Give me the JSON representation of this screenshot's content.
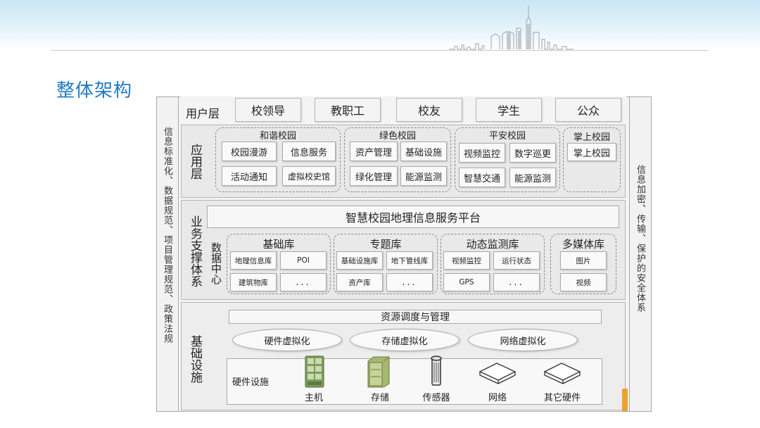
{
  "title": "整体架构",
  "left_bar": "信息标准化、数据规范、项目管理规范、政策法规",
  "right_bar": "信息加密、传输、保护的安全体系",
  "user_layer": {
    "label": "用户层",
    "items": [
      "校领导",
      "教职工",
      "校友",
      "学生",
      "公众"
    ]
  },
  "app_layer": {
    "label": "应用层",
    "groups": [
      {
        "title": "和谐校园",
        "items": [
          "校园漫游",
          "信息服务",
          "活动通知",
          "虚拟校史馆"
        ]
      },
      {
        "title": "绿色校园",
        "items": [
          "资产管理",
          "基础设施",
          "绿化管理",
          "能源监测"
        ]
      },
      {
        "title": "平安校园",
        "items": [
          "视频监控",
          "数字巡更",
          "智慧交通",
          "能源监测"
        ]
      },
      {
        "title": "掌上校园",
        "items": [
          "掌上校园"
        ]
      }
    ]
  },
  "support_layer": {
    "label": "业务支撑体系",
    "platform": "智慧校园地理信息服务平台",
    "data_center": "数据中心",
    "groups": [
      {
        "title": "基础库",
        "items": [
          "地理信息库",
          "POI",
          "建筑物库",
          "..."
        ]
      },
      {
        "title": "专题库",
        "items": [
          "基础设施库",
          "地下管线库",
          "资产库",
          "..."
        ]
      },
      {
        "title": "动态监测库",
        "items": [
          "视频监控",
          "运行状态",
          "GPS",
          "..."
        ]
      },
      {
        "title": "多媒体库",
        "items": [
          "图片",
          "视频"
        ]
      }
    ]
  },
  "infra_layer": {
    "label": "基础设施",
    "resource_bar": "资源调度与管理",
    "virtualization": [
      "硬件虚拟化",
      "存储虚拟化",
      "网络虚拟化"
    ],
    "hardware_label": "硬件设施",
    "hardware": [
      {
        "label": "主机",
        "icon": "server-rack-icon"
      },
      {
        "label": "存储",
        "icon": "storage-cabinet-icon"
      },
      {
        "label": "传感器",
        "icon": "sensor-cylinder-icon"
      },
      {
        "label": "网络",
        "icon": "network-device-icon"
      },
      {
        "label": "其它硬件",
        "icon": "network-device-icon"
      }
    ]
  },
  "colors": {
    "title": "#1f7ac1",
    "banner": "#c9e6f5",
    "panel": "#e9e9e9",
    "accent": "#f0a030"
  }
}
